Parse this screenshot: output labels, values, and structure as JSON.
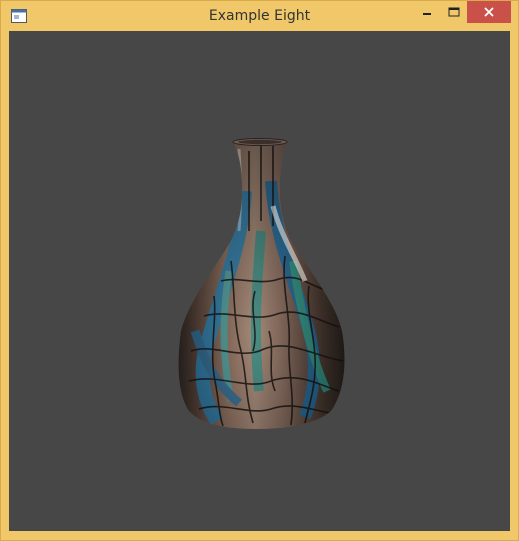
{
  "window": {
    "title": "Example Eight",
    "accent_color": "#f0c86a",
    "close_color": "#c9514a"
  },
  "titlebar": {
    "app_icon": "window-app-icon",
    "minimize_icon": "minimize-icon",
    "maximize_icon": "maximize-icon",
    "close_icon": "close-icon"
  },
  "viewport": {
    "background_color": "#474747",
    "scene": "textured-vase"
  }
}
